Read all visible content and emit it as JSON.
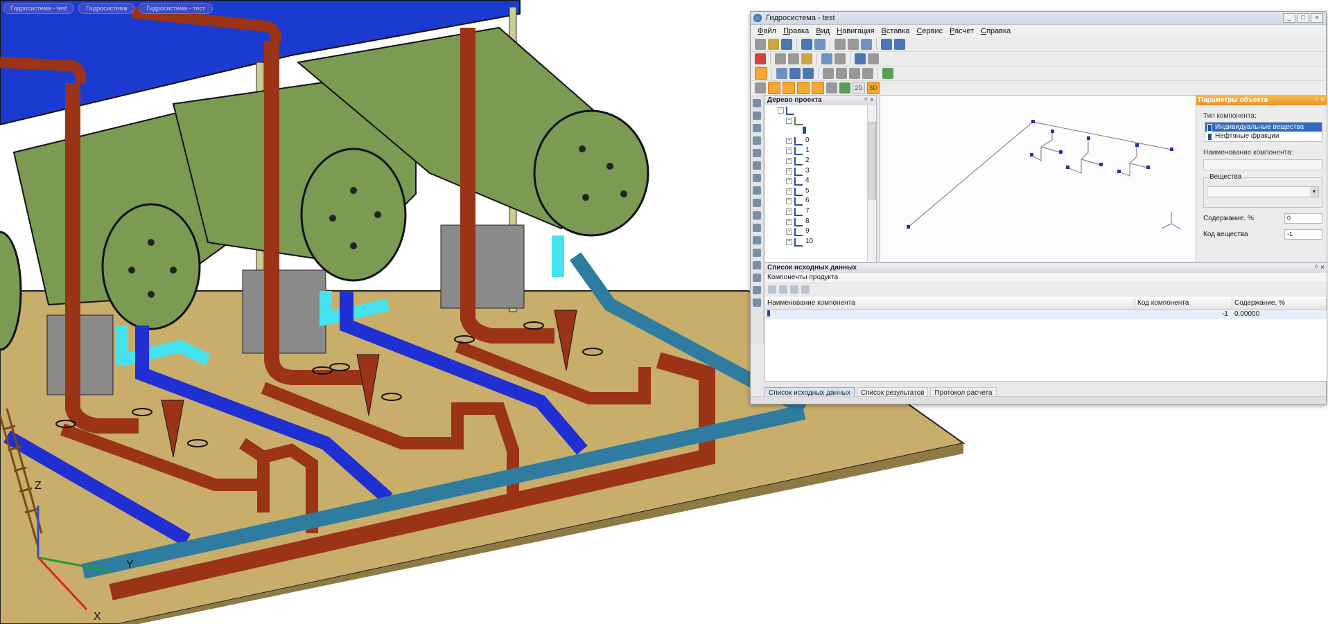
{
  "cad_tabs": [
    "Гидросистема - test",
    "Гидросистема",
    "Гидросистема - тест"
  ],
  "window": {
    "title": "Гидросистема - test",
    "controls": {
      "minimize": "_",
      "maximize": "□",
      "close": "×"
    }
  },
  "menu": [
    "Файл",
    "Правка",
    "Вид",
    "Навигация",
    "Вставка",
    "Сервис",
    "Расчет",
    "Справка"
  ],
  "toolbar3": {
    "btn2d": "2D",
    "btn3d": "3D"
  },
  "tree": {
    "title": "Дерево проекта",
    "items": [
      "0",
      "1",
      "2",
      "3",
      "4",
      "5",
      "6",
      "7",
      "8",
      "9",
      "10"
    ]
  },
  "params": {
    "title": "Параметры объекта",
    "component_type_label": "Тип компонента:",
    "component_types": [
      "Индивидуальные вещества",
      "Нефтяные фракции"
    ],
    "component_name_label": "Наименование компонента:",
    "substances_label": "Вещества",
    "content_label": "Содержание, %",
    "content_value": "0",
    "substance_code_label": "Код вещества",
    "substance_code_value": "-1"
  },
  "data_list": {
    "title": "Список исходных данных",
    "subtitle": "Компоненты продукта",
    "columns": [
      "Наименование компонента",
      "Код компонента",
      "Содержание, %"
    ],
    "rows": [
      [
        "",
        "-1",
        "0.00000"
      ]
    ]
  },
  "bottom_tabs": [
    "Список исходных данных",
    "Список результатов",
    "Протокол расчета"
  ],
  "axes": {
    "z": "Z",
    "y": "Y",
    "x": "X"
  },
  "colors": {
    "platform": "#c8ad6b",
    "roof": "#1b3bd0",
    "vessel": "#7b9a52",
    "red_pipe": "#9b3416",
    "blue_pipe": "#1f2fd2",
    "cyan_pipe": "#45e3f0",
    "teal_pipe": "#2e7da1",
    "panel_accent": "#f4a933"
  }
}
